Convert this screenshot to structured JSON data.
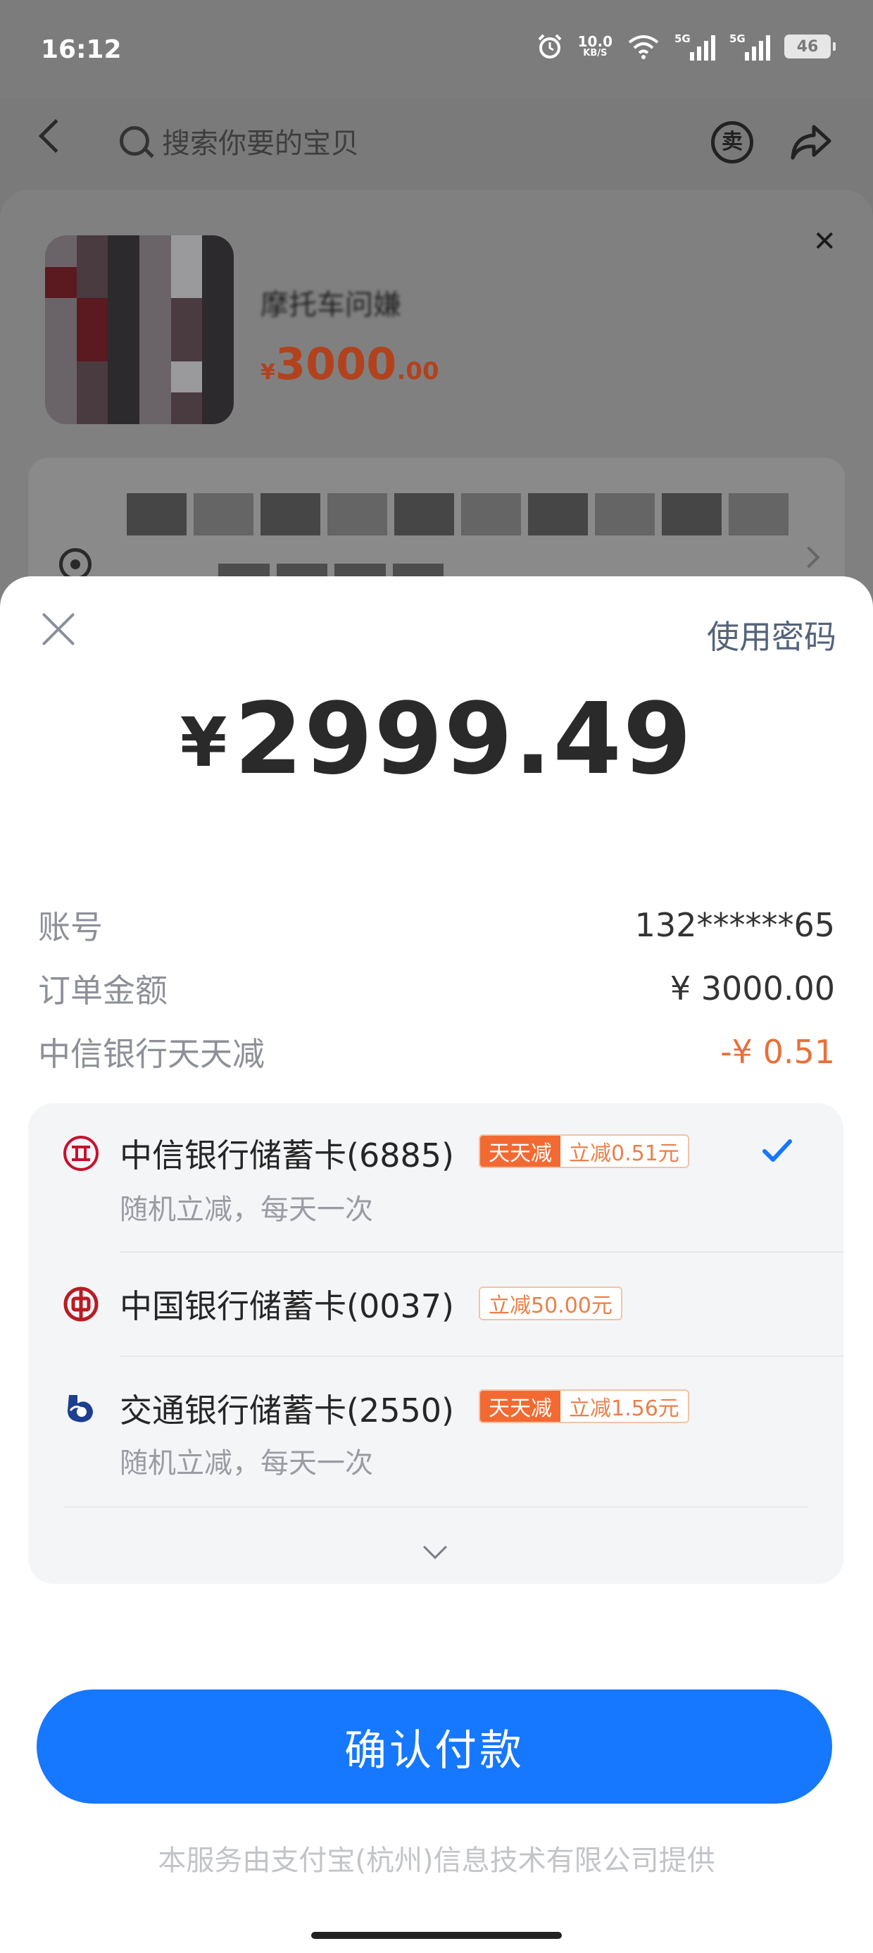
{
  "status_bar": {
    "time": "16:12",
    "net_speed_value": "10.0",
    "net_speed_unit": "KB/S",
    "signal1_label": "5G",
    "signal2_label": "5G",
    "battery": "46",
    "icons": [
      "alarm-icon",
      "wifi-icon",
      "signal-icon",
      "signal-icon",
      "battery-icon"
    ]
  },
  "app_header": {
    "search_placeholder": "搜索你要的宝贝",
    "sell_icon_text": "卖"
  },
  "product": {
    "name": "摩托车问嫌",
    "price_currency": "¥",
    "price_integer": "3000",
    "price_decimal": ".00"
  },
  "payment": {
    "use_password": "使用密码",
    "currency": "¥",
    "amount": "2999.49",
    "rows": [
      {
        "label": "账号",
        "value": "132******65"
      },
      {
        "label": "订单金额",
        "value": "¥ 3000.00"
      },
      {
        "label": "中信银行天天减",
        "value": "-¥ 0.51"
      }
    ],
    "cards": [
      {
        "name": "中信银行储蓄卡(6885)",
        "tag_daily": "天天减",
        "tag_discount": "立减0.51元",
        "sub": "随机立减，每天一次",
        "selected": true
      },
      {
        "name": "中国银行储蓄卡(0037)",
        "tag_discount": "立减50.00元"
      },
      {
        "name": "交通银行储蓄卡(2550)",
        "tag_daily": "天天减",
        "tag_discount": "立减1.56元",
        "sub": "随机立减，每天一次"
      }
    ],
    "confirm_label": "确认付款",
    "footer": "本服务由支付宝(杭州)信息技术有限公司提供"
  },
  "colors": {
    "primary_button": "#1677ff",
    "discount_text": "#e8703a",
    "tag_orange": "#f26a32",
    "price_red": "#b2421e"
  }
}
